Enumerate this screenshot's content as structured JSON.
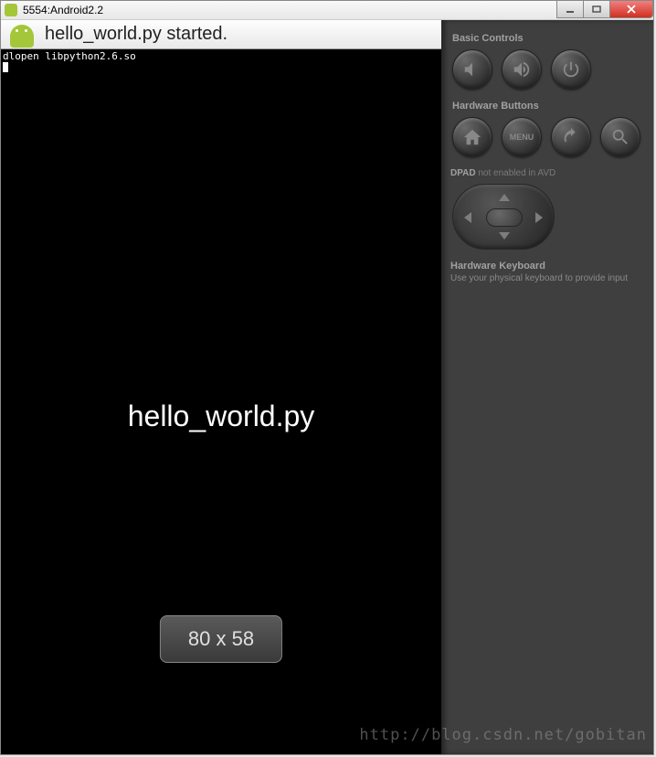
{
  "window": {
    "title": "5554:Android2.2"
  },
  "app": {
    "header_text": "hello_world.py started.",
    "console_line": "dlopen libpython2.6.so",
    "center_text": "hello_world.py",
    "toast_text": "80 x 58"
  },
  "panel": {
    "basic_controls_label": "Basic Controls",
    "hardware_buttons_label": "Hardware Buttons",
    "menu_label": "MENU",
    "dpad_prefix": "DPAD",
    "dpad_note": "not enabled in AVD",
    "kbd_label": "Hardware Keyboard",
    "kbd_sub": "Use your physical keyboard to provide input"
  },
  "watermark": "http://blog.csdn.net/gobitan"
}
